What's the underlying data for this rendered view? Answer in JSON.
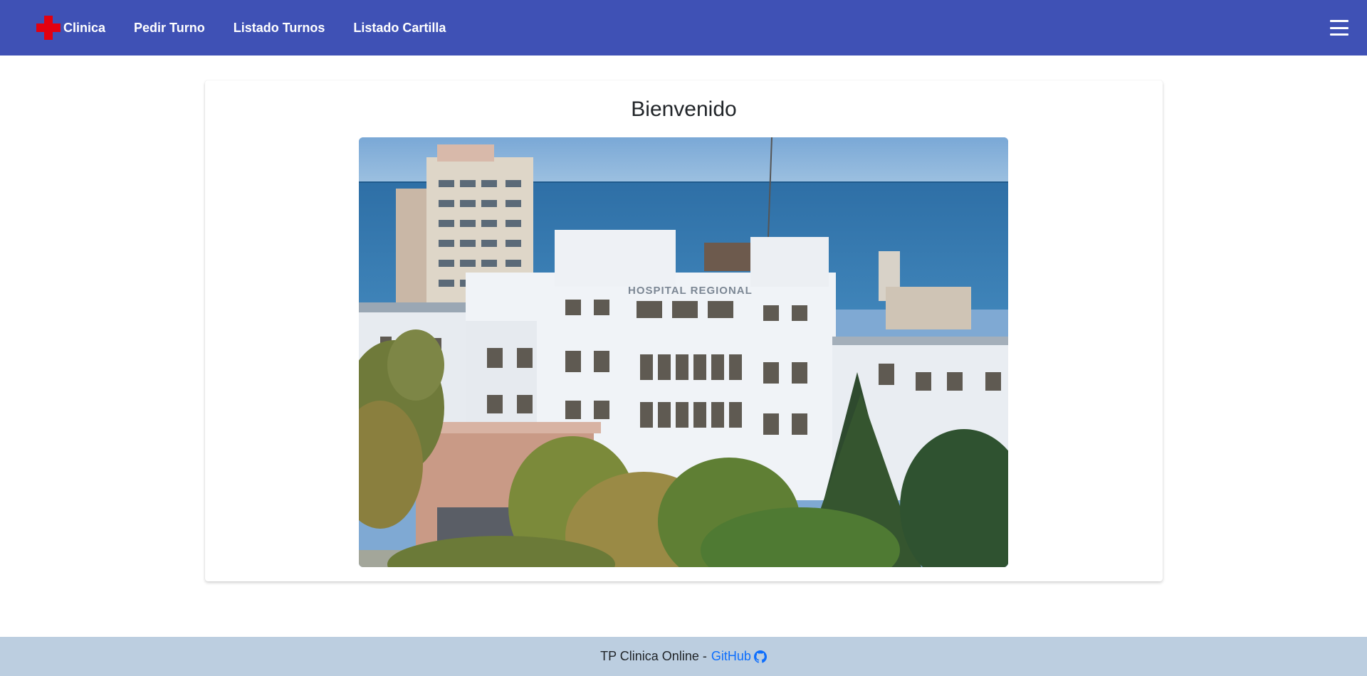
{
  "navbar": {
    "brand_icon": "red-cross-icon",
    "brand_label": "Clinica",
    "links": [
      {
        "label": "Pedir Turno"
      },
      {
        "label": "Listado Turnos"
      },
      {
        "label": "Listado Cartilla"
      }
    ],
    "menu_icon": "hamburger-menu-icon",
    "bg_color": "#3f51b5",
    "cross_color": "#e3000f"
  },
  "main": {
    "title": "Bienvenido",
    "image": {
      "subject": "hospital-building-photo",
      "building_sign": "HOSPITAL REGIONAL"
    }
  },
  "footer": {
    "text": "TP Clinica Online -",
    "link_label": "GitHub",
    "link_icon": "github-icon",
    "bg_color": "#bccee0",
    "link_color": "#0d6efd"
  }
}
